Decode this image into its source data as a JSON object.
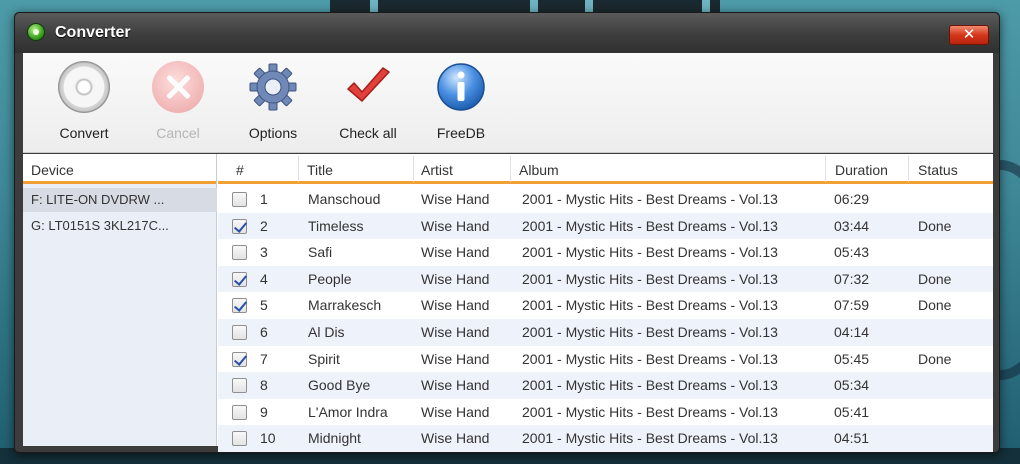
{
  "window": {
    "title": "Converter",
    "close_glyph": "✕"
  },
  "toolbar": {
    "items": [
      {
        "label": "Convert",
        "icon": "disc-icon",
        "enabled": true
      },
      {
        "label": "Cancel",
        "icon": "cancel-icon",
        "enabled": false
      },
      {
        "label": "Options",
        "icon": "gear-icon",
        "enabled": true
      },
      {
        "label": "Check all",
        "icon": "checkmark-icon",
        "enabled": true
      },
      {
        "label": "FreeDB",
        "icon": "info-icon",
        "enabled": true
      }
    ]
  },
  "devices": {
    "header": "Device",
    "items": [
      {
        "label": "F: LITE-ON DVDRW ...",
        "selected": true
      },
      {
        "label": "G: LT0151S 3KL217C...",
        "selected": false
      }
    ]
  },
  "tracks": {
    "columns": [
      "#",
      "Title",
      "Artist",
      "Album",
      "Duration",
      "Status"
    ],
    "rows": [
      {
        "checked": false,
        "num": "1",
        "title": "Manschoud",
        "artist": "Wise Hand",
        "album": "2001 - Mystic Hits - Best Dreams - Vol.13",
        "duration": "06:29",
        "status": ""
      },
      {
        "checked": true,
        "num": "2",
        "title": "Timeless",
        "artist": "Wise Hand",
        "album": "2001 - Mystic Hits - Best Dreams - Vol.13",
        "duration": "03:44",
        "status": "Done"
      },
      {
        "checked": false,
        "num": "3",
        "title": "Safi",
        "artist": "Wise Hand",
        "album": "2001 - Mystic Hits - Best Dreams - Vol.13",
        "duration": "05:43",
        "status": ""
      },
      {
        "checked": true,
        "num": "4",
        "title": "People",
        "artist": "Wise Hand",
        "album": "2001 - Mystic Hits - Best Dreams - Vol.13",
        "duration": "07:32",
        "status": "Done"
      },
      {
        "checked": true,
        "num": "5",
        "title": "Marrakesch",
        "artist": "Wise Hand",
        "album": "2001 - Mystic Hits - Best Dreams - Vol.13",
        "duration": "07:59",
        "status": "Done"
      },
      {
        "checked": false,
        "num": "6",
        "title": "Al Dis",
        "artist": "Wise Hand",
        "album": "2001 - Mystic Hits - Best Dreams - Vol.13",
        "duration": "04:14",
        "status": ""
      },
      {
        "checked": true,
        "num": "7",
        "title": "Spirit",
        "artist": "Wise Hand",
        "album": "2001 - Mystic Hits - Best Dreams - Vol.13",
        "duration": "05:45",
        "status": "Done"
      },
      {
        "checked": false,
        "num": "8",
        "title": "Good Bye",
        "artist": "Wise Hand",
        "album": "2001 - Mystic Hits - Best Dreams - Vol.13",
        "duration": "05:34",
        "status": ""
      },
      {
        "checked": false,
        "num": "9",
        "title": "L'Amor Indra",
        "artist": "Wise Hand",
        "album": "2001 - Mystic Hits - Best Dreams - Vol.13",
        "duration": "05:41",
        "status": ""
      },
      {
        "checked": false,
        "num": "10",
        "title": "Midnight",
        "artist": "Wise Hand",
        "album": "2001 - Mystic Hits - Best Dreams - Vol.13",
        "duration": "04:51",
        "status": ""
      }
    ]
  },
  "colors": {
    "accent": "#f0a035",
    "selection": "#d6dbe4",
    "row_alt": "#eef3fb"
  }
}
